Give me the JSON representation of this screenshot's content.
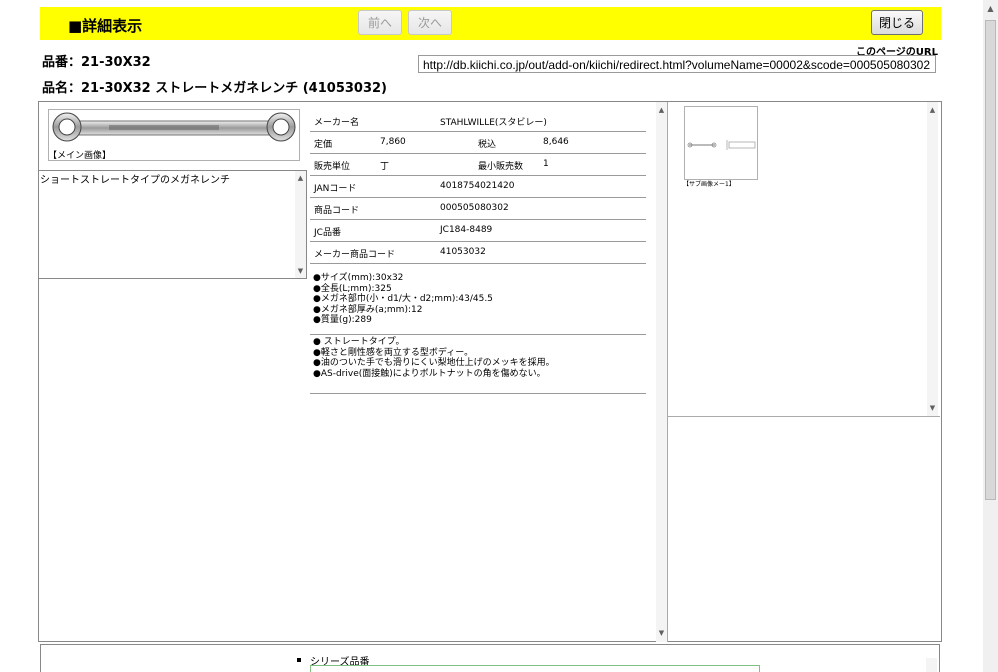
{
  "header": {
    "title": "■詳細表示",
    "prev_label": "前へ",
    "next_label": "次へ",
    "close_label": "閉じる"
  },
  "page_url": {
    "label": "このページのURL",
    "value": "http://db.kiichi.co.jp/out/add-on/kiichi/redirect.html?volumeName=00002&scode=000505080302"
  },
  "product": {
    "part_number": "品番：21-30X32",
    "part_name": "品名：21-30X32 ストレートメガネレンチ (41053032)"
  },
  "main_image": {
    "caption": "【メイン画像】"
  },
  "description": "ショートストレートタイプのメガネレンチ",
  "specs": {
    "maker_label": "メーカー名",
    "maker_value": "STAHLWILLE(スタビレー)",
    "list_price_label": "定価",
    "list_price_value": "7,860",
    "tax_incl_label": "税込",
    "tax_incl_value": "8,646",
    "unit_label": "販売単位",
    "unit_value": "丁",
    "min_qty_label": "最小販売数",
    "min_qty_value": "1",
    "jan_label": "JANコード",
    "jan_value": "4018754021420",
    "product_code_label": "商品コード",
    "product_code_value": "000505080302",
    "jc_label": "JC品番",
    "jc_value": "JC184-8489",
    "maker_code_label": "メーカー商品コード",
    "maker_code_value": "41053032"
  },
  "features": [
    "●サイズ(mm):30x32",
    "●全長(L;mm):325",
    "●メガネ部巾(小・d1/大・d2;mm):43/45.5",
    "●メガネ部厚み(a;mm):12",
    "●質量(g):289"
  ],
  "bullets": [
    "● ストレートタイプ。",
    "●軽さと剛性感を両立する型ボディー。",
    "●油のついた手でも滑りにくい梨地仕上げのメッキを採用。",
    "●AS-drive(面接触)によりボルトナットの角を傷めない。"
  ],
  "sub_image": {
    "caption": "【サブ画像メー1】"
  },
  "series": {
    "label": "シリーズ品番"
  },
  "icons": {
    "scroll_up": "scroll-up-icon",
    "scroll_down": "scroll-down-icon",
    "series_bullet": "square-bullet-icon"
  }
}
